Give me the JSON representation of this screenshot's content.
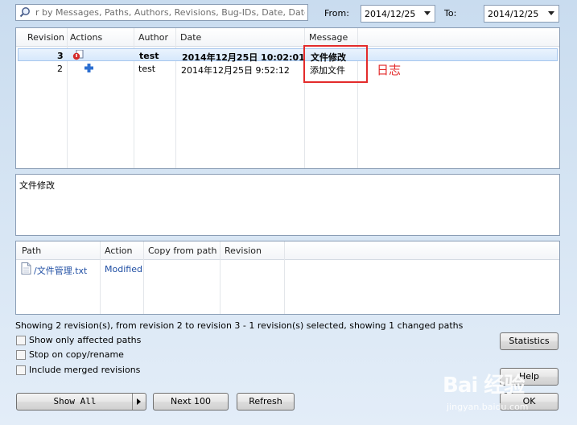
{
  "filter": {
    "search_placeholder": "r by Messages, Paths, Authors, Revisions, Bug-IDs, Date, Date R",
    "from_label": "From:",
    "from_value": "2014/12/25",
    "to_label": "To:",
    "to_value": "2014/12/25"
  },
  "log": {
    "headers": [
      "Revision",
      "Actions",
      "Author",
      "Date",
      "Message"
    ],
    "rows": [
      {
        "revision": "3",
        "author": "test",
        "date": "2014年12月25日 10:02:01",
        "message": "文件修改",
        "selected": true
      },
      {
        "revision": "2",
        "author": "test",
        "date": "2014年12月25日 9:52:12",
        "message": "添加文件",
        "selected": false
      }
    ]
  },
  "annotation": "日志",
  "message_text": "文件修改",
  "paths": {
    "headers": [
      "Path",
      "Action",
      "Copy from path",
      "Revision"
    ],
    "rows": [
      {
        "path": "/文件管理.txt",
        "action": "Modified"
      }
    ]
  },
  "status_text": "Showing 2 revision(s), from revision 2 to revision 3 - 1 revision(s) selected, showing 1 changed paths",
  "options": {
    "show_only_affected": "Show only affected paths",
    "stop_on_copy": "Stop on copy/rename",
    "include_merged": "Include merged revisions"
  },
  "buttons": {
    "statistics": "Statistics",
    "help": "Help",
    "show_all": "Show All",
    "next_100": "Next 100",
    "refresh": "Refresh",
    "ok": "OK"
  },
  "watermark": {
    "logo": "Bai 经验",
    "url": "jingyan.baidu.com"
  }
}
